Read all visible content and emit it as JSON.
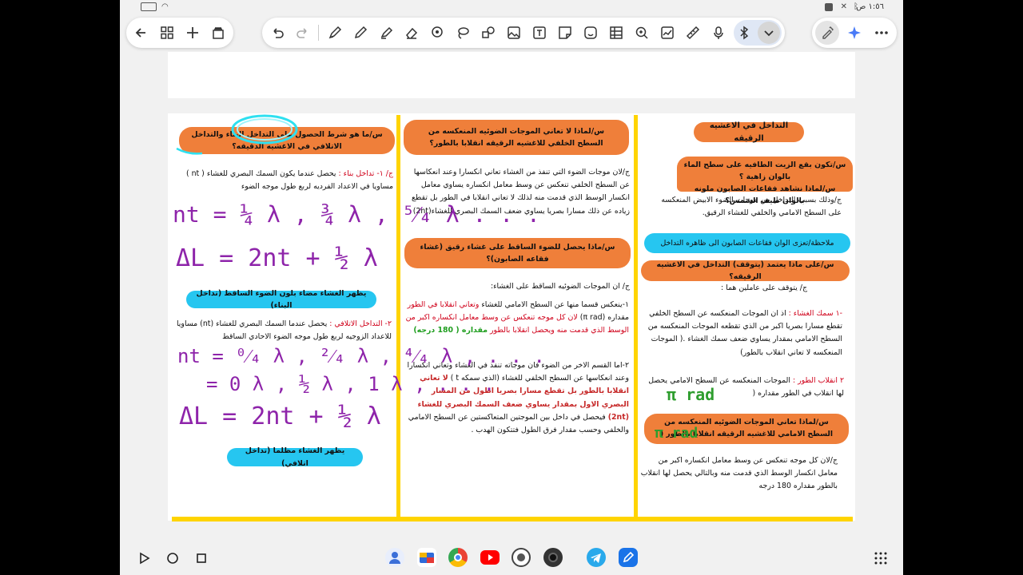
{
  "status": {
    "time": "١:٥٦ ص"
  },
  "toolbar": {
    "left_tools": [
      "back-arrow-icon",
      "grid-icon",
      "plus-icon",
      "pages-icon"
    ],
    "main_tools": [
      "undo-icon",
      "redo-icon",
      "pen-icon",
      "pen2-icon",
      "highlighter-icon",
      "eraser-icon",
      "lasso-icon",
      "lasso2-icon",
      "shapes-icon",
      "image-icon",
      "textbox-icon",
      "sticky-note-icon",
      "sticker-icon",
      "table-icon",
      "zoom-icon",
      "chart-icon",
      "ruler-icon",
      "mic-icon",
      "bluetooth-pen-icon",
      "chevron-down-icon"
    ],
    "right_tools": [
      "auto-brush-icon",
      "ai-sparkle-icon",
      "more-icon"
    ]
  },
  "col1": {
    "title": "التداخل في الاغشيه الرقيقه",
    "q1": "س/تكون بقع الزيت الطافيه على سطح الماء بالوان زاهية ؟",
    "q2": "س/لماذا نشاهد فقاعات الصابون ملونه بالوان طيف الشمس؟",
    "a1": "ج/وذلك بسبب التداخل بين موجات الضوء الابيض المنعكسه على السطح الامامي والخلفي للغشاء الرقيق.",
    "note": "ملاحظة/تعزى الوان فقاعات الصابون الى ظاهره التداخل",
    "q3": "س/على ماذا يعتمد (يتوقف) التداخل في الاغشيه الرقيقه؟",
    "a3_intro": "ج/ يتوقف على عاملين هما :",
    "f1_label": "-١ سمك الغشاء :",
    "f1_text": "اذ ان الموجات المنعكسه عن السطح الخلفي تقطع مسارا بصريا اكبر من الذي تقطعه الموجات المنعكسه من السطح الامامي بمقدار يساوي ضعف سمك الغشاء .( الموجات المنعكسه لا تعاني انقلاب بالطور)",
    "f2_label": "٢ انقلاب الطور :",
    "f2_text": "الموجات المنعكسه عن السطح الامامي يحصل لها انقلاب في الطور مقداره (",
    "f2_hand": "π rad",
    "q4": "س/لماذا تعاني الموجات الضوئيه المنعكسه من السطح الامامي للاغشيه الرقيقه انقلابا بالطور (",
    "q4_hand": "π rad",
    "a4": "ج/لان كل موجه تنعكس عن وسط معامل انكساره اكبر من معامل انكسار الوسط الذي قدمت منه وبالتالي يحصل لها انقلاب بالطور مقداره 180 درجه"
  },
  "col2": {
    "q1": "س/لماذا لا تعاني الموجات الضوئيه المنعكسه من السطح الخلفي للاغشيه الرقيقه انقلابا بالطور؟",
    "a1": "ج/لان موجات الضوء التي تنفذ من الغشاء تعاني انكسارا وعند انعكاسها عن السطح الخلفي تنعكس عن وسط معامل انكساره يساوي معامل انكسار الوسط الذي قدمت منه لذلك لا تعاني انقلابا في الطور بل تقطع زياده عن ذلك مسارا بصريا يساوي ضعف السمك البصري للغشاء(2nt)",
    "q2": "س/ماذا يحصل للضوء الساقط على غشاء رقيق (غشاء فقاعه الصابون)؟",
    "a2_intro": "ج/ ان الموجات الضوئيه الساقط على الغشاء:",
    "p1_a": "١-ينعكس قسما منها عن السطح الامامي للغشاء",
    "p1_red1": "وتعاني انقلابا في الطور",
    "p1_b": "مقداره (π rad)",
    "p1_red2": "لان كل موجه تنعكس عن وسط معامل انكساره اكبر من الوسط الذي قدمت منه ويحصل انقلابا بالطور",
    "p1_grn": "مقداره ( 180 درجه)",
    "p2_a": "٢-اما القسم الاخر من الضوء فان موجاته تنفذ في الغشاء وتعاني انكسارا وعند انعكاسها عن السطح الخلفي للغشاء (الذي سمكه t )",
    "p2_red": "لا تعاني انقلابا بالطور بل تقطع مسارا بصريا اطول من المسار البصري الاول بمقدار يساوي ضعف السمك البصري للغشاء (2nt)",
    "p2_b": "فيحصل في داخل بين الموجتين المتعاكستين عن السطح الامامي والخلفي وحسب مقدار فرق الطول فتتكون الهدب ."
  },
  "col3": {
    "q1": "س/ما هو شرط الحصول على التداخل البناء والتداخل الاتلافي في الاغشيه الدقيقه؟",
    "c1_label": "ج/ ١- تداخل بناء :",
    "c1_text": "يحصل عندما يكون السمك البصري للغشاء ( nt ) مساويا في الاعداد الفرديه لربع طول موجه الضوء",
    "eq1": "nt = ¼ λ , ¾ λ , ⁵⁄₄ λ . . .",
    "eq2": "ΔL = 2nt + ½ λ",
    "b1": "يظهر الغشاء مضاء بلون الضوء الساقط (تداخل البناء)",
    "c2_label": "٢- التداخل الاتلافي :",
    "c2_text": "يحصل عندما السمك البصري للغشاء (nt) مساويا للاعداد الزوجيه لربع طول موجه الضوء الاحادي الساقط",
    "eq3": "nt = ⁰⁄₄ λ , ²⁄₄ λ , ⁴⁄₄ λ , . . .",
    "eq4": "= 0 λ , ½ λ , 1 λ , . . .",
    "eq5": "ΔL = 2nt + ½ λ",
    "b2": "يظهر الغشاء مظلما (تداخل اتلافي)"
  },
  "colors": {
    "orange": "#ef7f3a",
    "cyan": "#26c6f0",
    "yellow": "#ffd400",
    "purple": "#8e24aa"
  },
  "navbar": {
    "buttons": [
      "back-triangle-icon",
      "home-circle-icon",
      "recents-square-icon"
    ],
    "apps": [
      "contacts-app",
      "files-app",
      "chrome-app",
      "youtube-app",
      "camera-app",
      "lens-app",
      "telegram-app",
      "notes-app"
    ],
    "grid": "app-drawer-icon"
  }
}
